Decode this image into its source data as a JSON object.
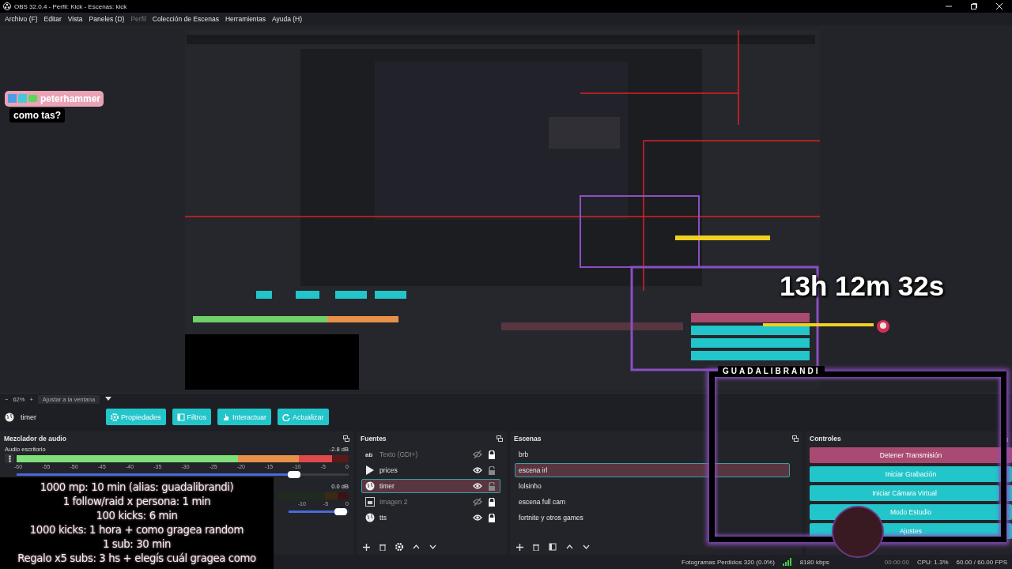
{
  "window": {
    "title": "OBS 32.0.4 - Perfil: Kick - Escenas: kick"
  },
  "menu": [
    {
      "label": "Archivo (F)",
      "disabled": false
    },
    {
      "label": "Editar",
      "disabled": false
    },
    {
      "label": "Vista",
      "disabled": false
    },
    {
      "label": "Paneles (D)",
      "disabled": false
    },
    {
      "label": "Perfil",
      "disabled": true
    },
    {
      "label": "Colección de Escenas",
      "disabled": false
    },
    {
      "label": "Herramientas",
      "disabled": false
    },
    {
      "label": "Ayuda (H)",
      "disabled": false
    }
  ],
  "chat_overlay": {
    "username": "peterhammer",
    "message": "como tas?"
  },
  "timer_overlay": {
    "text": "13h 12m 32s"
  },
  "zoom_bar": {
    "minus": "−",
    "zoom": "62%",
    "plus": "+",
    "fit": "Ajustar a la ventana"
  },
  "source_toolbar": {
    "source": "timer",
    "buttons": [
      {
        "label": "Propiedades",
        "kind": "gear"
      },
      {
        "label": "Filtros",
        "kind": "filter"
      },
      {
        "label": "Interactuar",
        "kind": "hand"
      },
      {
        "label": "Actualizar",
        "kind": "refresh"
      }
    ]
  },
  "mixer": {
    "title": "Mezclador de audio",
    "channels": [
      {
        "name": "Audio escritorio",
        "reading": "-2.8 dB",
        "meter": {
          "level": 0.95
        },
        "volume": {
          "level": 0.85
        },
        "ticks": [
          "-60",
          "-55",
          "-50",
          "-45",
          "-40",
          "-35",
          "-30",
          "-25",
          "-20",
          "-15",
          "-10",
          "-5",
          "0"
        ]
      },
      {
        "reading": "0.0 dB",
        "volume": {
          "level": 0.97
        },
        "ticks": [
          "-10",
          "-5",
          "0"
        ]
      }
    ]
  },
  "timer_text_overlay": {
    "lines": [
      "1000 mp: 10 min (alias: guadalibrandi)",
      "1 follow/raid x persona: 1 min",
      "100 kicks: 6 min",
      "1000 kicks: 1 hora + como gragea random",
      "1 sub: 30 min",
      "Regalo x5 subs: 3 hs + elegís cuál gragea como"
    ]
  },
  "sources": {
    "title": "Fuentes",
    "items": [
      {
        "name": "Texto (GDI+)",
        "kind": "text",
        "badge": "ab",
        "visible": false,
        "locked": true,
        "selected": false
      },
      {
        "name": "prices",
        "kind": "media",
        "visible": true,
        "locked": false,
        "selected": false
      },
      {
        "name": "timer",
        "kind": "browser",
        "visible": true,
        "locked": false,
        "selected": true
      },
      {
        "name": "Imagen 2",
        "kind": "image",
        "visible": false,
        "locked": true,
        "selected": false
      },
      {
        "name": "tts",
        "kind": "browser",
        "visible": true,
        "locked": true,
        "selected": false
      }
    ]
  },
  "scenes": {
    "title": "Escenas",
    "items": [
      {
        "name": "brb",
        "selected": false
      },
      {
        "name": "escena irl",
        "selected": true
      },
      {
        "name": "lolsinho",
        "selected": false
      },
      {
        "name": "escena full cam",
        "selected": false
      },
      {
        "name": "fortnite y otros games",
        "selected": false
      }
    ]
  },
  "controls": {
    "title": "Controles",
    "buttons": [
      {
        "label": "Detener Transmisión",
        "active": true
      },
      {
        "label": "Iniciar Grabación",
        "active": false
      },
      {
        "label": "Iniciar Cámara Virtual",
        "active": false
      },
      {
        "label": "Modo Estudio",
        "active": false
      },
      {
        "label": "Ajustes",
        "active": false
      }
    ]
  },
  "webcam_overlay": {
    "label": "GUADALIBRANDI"
  },
  "status_bar": {
    "dropped": "Fotogramas Perdidos 320 (0.0%)",
    "bitrate": "8180 kbps",
    "time": "00:00:00",
    "cpu": "CPU: 1.3%",
    "fps": "60.00 / 60.00 FPS"
  }
}
